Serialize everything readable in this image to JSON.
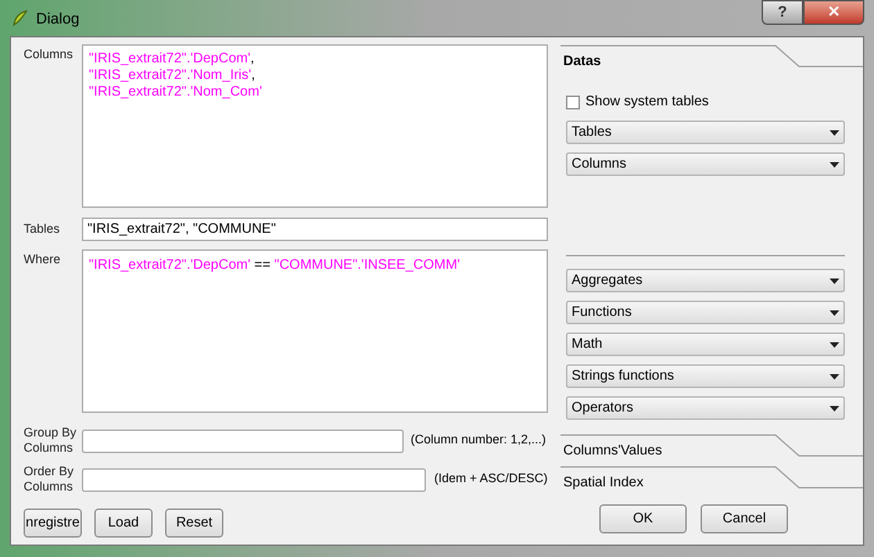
{
  "window": {
    "title": "Dialog",
    "buttons": [
      {
        "kind": "help",
        "label": "?"
      },
      {
        "kind": "close",
        "label": "✕"
      }
    ]
  },
  "columns": {
    "label": "Columns",
    "lines": [
      [
        {
          "kind": "ident",
          "text": "\"IRIS_extrait72\".'DepCom'"
        },
        {
          "kind": "plain",
          "text": ","
        }
      ],
      [
        {
          "kind": "ident",
          "text": "\"IRIS_extrait72\".'Nom_Iris'"
        },
        {
          "kind": "plain",
          "text": ","
        }
      ],
      [
        {
          "kind": "ident",
          "text": "\"IRIS_extrait72\".'Nom_Com'"
        }
      ]
    ]
  },
  "tables": {
    "label": "Tables",
    "value": "\"IRIS_extrait72\", \"COMMUNE\""
  },
  "where": {
    "label": "Where",
    "lines": [
      [
        {
          "kind": "ident",
          "text": "\"IRIS_extrait72\".'DepCom'"
        },
        {
          "kind": "plain",
          "text": " == "
        },
        {
          "kind": "ident",
          "text": "\"COMMUNE\".'INSEE_COMM'"
        }
      ]
    ]
  },
  "group_by": {
    "label": "Group By Columns",
    "hint": "(Column number: 1,2,...)"
  },
  "order_by": {
    "label": "Order By Columns",
    "hint": "(Idem + ASC/DESC)"
  },
  "left_buttons": [
    "nregistre",
    "Load",
    "Reset"
  ],
  "toolbox": {
    "datas": {
      "title": "Datas",
      "show_system_tables": {
        "label": "Show system tables",
        "checked": false
      },
      "combos": [
        "Tables",
        "Columns"
      ]
    },
    "combos": [
      "Aggregates",
      "Functions",
      "Math",
      "Strings functions",
      "Operators"
    ],
    "sections": [
      "Columns'Values",
      "Spatial Index"
    ]
  },
  "dialog_buttons": [
    "OK",
    "Cancel"
  ]
}
